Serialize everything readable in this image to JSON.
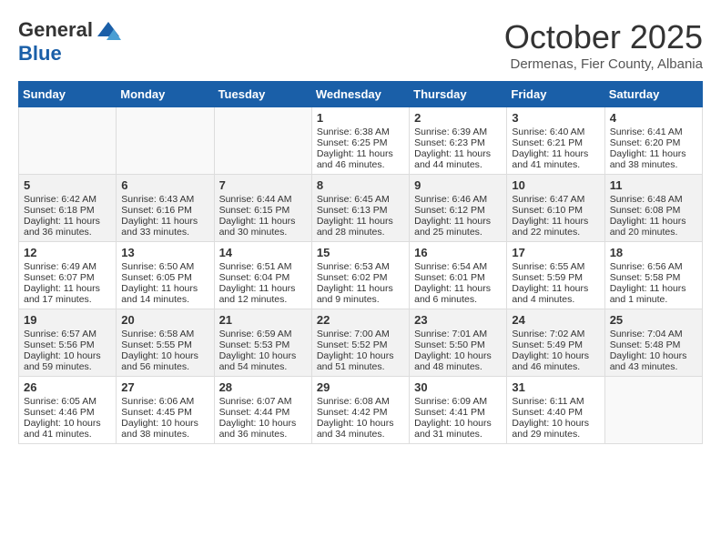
{
  "header": {
    "logo_general": "General",
    "logo_blue": "Blue",
    "month": "October 2025",
    "location": "Dermenas, Fier County, Albania"
  },
  "days_of_week": [
    "Sunday",
    "Monday",
    "Tuesday",
    "Wednesday",
    "Thursday",
    "Friday",
    "Saturday"
  ],
  "weeks": [
    [
      {
        "day": "",
        "info": ""
      },
      {
        "day": "",
        "info": ""
      },
      {
        "day": "",
        "info": ""
      },
      {
        "day": "1",
        "info": "Sunrise: 6:38 AM\nSunset: 6:25 PM\nDaylight: 11 hours\nand 46 minutes."
      },
      {
        "day": "2",
        "info": "Sunrise: 6:39 AM\nSunset: 6:23 PM\nDaylight: 11 hours\nand 44 minutes."
      },
      {
        "day": "3",
        "info": "Sunrise: 6:40 AM\nSunset: 6:21 PM\nDaylight: 11 hours\nand 41 minutes."
      },
      {
        "day": "4",
        "info": "Sunrise: 6:41 AM\nSunset: 6:20 PM\nDaylight: 11 hours\nand 38 minutes."
      }
    ],
    [
      {
        "day": "5",
        "info": "Sunrise: 6:42 AM\nSunset: 6:18 PM\nDaylight: 11 hours\nand 36 minutes."
      },
      {
        "day": "6",
        "info": "Sunrise: 6:43 AM\nSunset: 6:16 PM\nDaylight: 11 hours\nand 33 minutes."
      },
      {
        "day": "7",
        "info": "Sunrise: 6:44 AM\nSunset: 6:15 PM\nDaylight: 11 hours\nand 30 minutes."
      },
      {
        "day": "8",
        "info": "Sunrise: 6:45 AM\nSunset: 6:13 PM\nDaylight: 11 hours\nand 28 minutes."
      },
      {
        "day": "9",
        "info": "Sunrise: 6:46 AM\nSunset: 6:12 PM\nDaylight: 11 hours\nand 25 minutes."
      },
      {
        "day": "10",
        "info": "Sunrise: 6:47 AM\nSunset: 6:10 PM\nDaylight: 11 hours\nand 22 minutes."
      },
      {
        "day": "11",
        "info": "Sunrise: 6:48 AM\nSunset: 6:08 PM\nDaylight: 11 hours\nand 20 minutes."
      }
    ],
    [
      {
        "day": "12",
        "info": "Sunrise: 6:49 AM\nSunset: 6:07 PM\nDaylight: 11 hours\nand 17 minutes."
      },
      {
        "day": "13",
        "info": "Sunrise: 6:50 AM\nSunset: 6:05 PM\nDaylight: 11 hours\nand 14 minutes."
      },
      {
        "day": "14",
        "info": "Sunrise: 6:51 AM\nSunset: 6:04 PM\nDaylight: 11 hours\nand 12 minutes."
      },
      {
        "day": "15",
        "info": "Sunrise: 6:53 AM\nSunset: 6:02 PM\nDaylight: 11 hours\nand 9 minutes."
      },
      {
        "day": "16",
        "info": "Sunrise: 6:54 AM\nSunset: 6:01 PM\nDaylight: 11 hours\nand 6 minutes."
      },
      {
        "day": "17",
        "info": "Sunrise: 6:55 AM\nSunset: 5:59 PM\nDaylight: 11 hours\nand 4 minutes."
      },
      {
        "day": "18",
        "info": "Sunrise: 6:56 AM\nSunset: 5:58 PM\nDaylight: 11 hours\nand 1 minute."
      }
    ],
    [
      {
        "day": "19",
        "info": "Sunrise: 6:57 AM\nSunset: 5:56 PM\nDaylight: 10 hours\nand 59 minutes."
      },
      {
        "day": "20",
        "info": "Sunrise: 6:58 AM\nSunset: 5:55 PM\nDaylight: 10 hours\nand 56 minutes."
      },
      {
        "day": "21",
        "info": "Sunrise: 6:59 AM\nSunset: 5:53 PM\nDaylight: 10 hours\nand 54 minutes."
      },
      {
        "day": "22",
        "info": "Sunrise: 7:00 AM\nSunset: 5:52 PM\nDaylight: 10 hours\nand 51 minutes."
      },
      {
        "day": "23",
        "info": "Sunrise: 7:01 AM\nSunset: 5:50 PM\nDaylight: 10 hours\nand 48 minutes."
      },
      {
        "day": "24",
        "info": "Sunrise: 7:02 AM\nSunset: 5:49 PM\nDaylight: 10 hours\nand 46 minutes."
      },
      {
        "day": "25",
        "info": "Sunrise: 7:04 AM\nSunset: 5:48 PM\nDaylight: 10 hours\nand 43 minutes."
      }
    ],
    [
      {
        "day": "26",
        "info": "Sunrise: 6:05 AM\nSunset: 4:46 PM\nDaylight: 10 hours\nand 41 minutes."
      },
      {
        "day": "27",
        "info": "Sunrise: 6:06 AM\nSunset: 4:45 PM\nDaylight: 10 hours\nand 38 minutes."
      },
      {
        "day": "28",
        "info": "Sunrise: 6:07 AM\nSunset: 4:44 PM\nDaylight: 10 hours\nand 36 minutes."
      },
      {
        "day": "29",
        "info": "Sunrise: 6:08 AM\nSunset: 4:42 PM\nDaylight: 10 hours\nand 34 minutes."
      },
      {
        "day": "30",
        "info": "Sunrise: 6:09 AM\nSunset: 4:41 PM\nDaylight: 10 hours\nand 31 minutes."
      },
      {
        "day": "31",
        "info": "Sunrise: 6:11 AM\nSunset: 4:40 PM\nDaylight: 10 hours\nand 29 minutes."
      },
      {
        "day": "",
        "info": ""
      }
    ]
  ]
}
